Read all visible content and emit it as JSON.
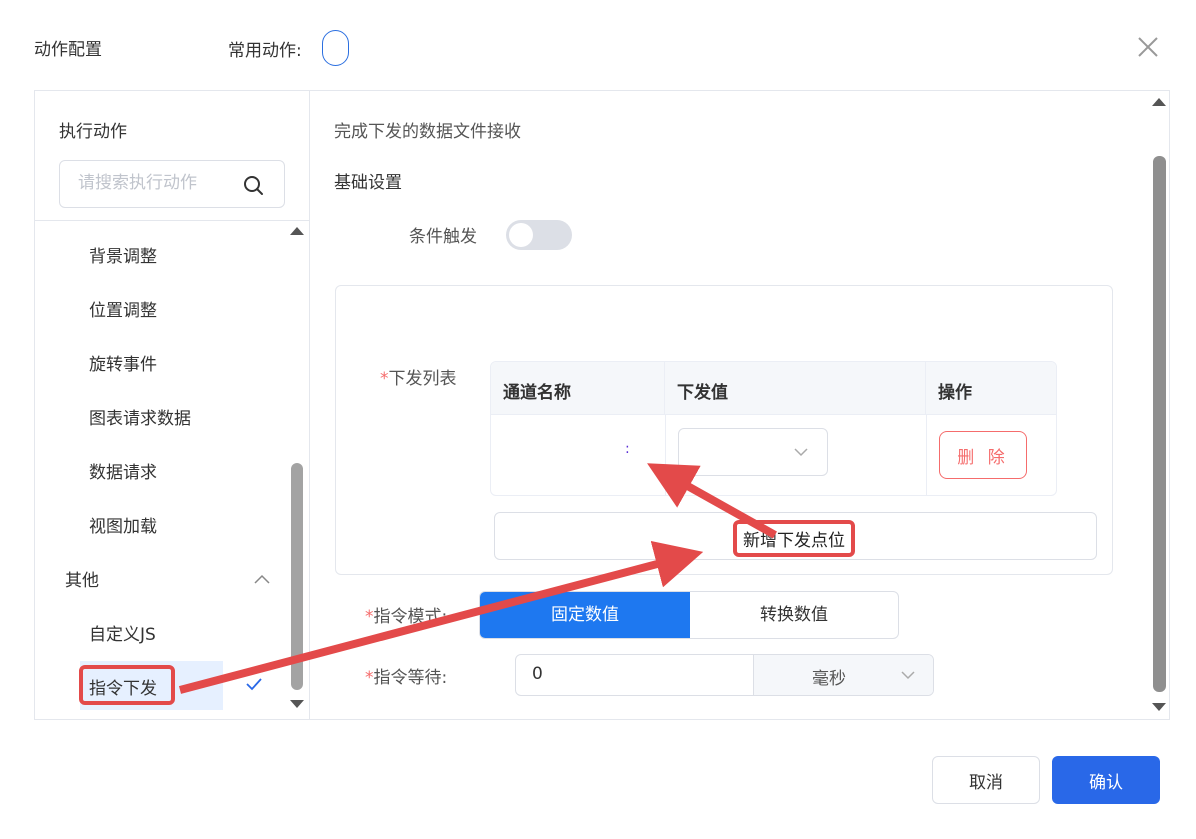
{
  "header": {
    "title": "动作配置",
    "common_actions_label": "常用动作:"
  },
  "left_panel": {
    "title": "执行动作",
    "search_placeholder": "请搜索执行动作",
    "items": [
      {
        "label": "背景调整"
      },
      {
        "label": "位置调整"
      },
      {
        "label": "旋转事件"
      },
      {
        "label": "图表请求数据"
      },
      {
        "label": "数据请求"
      },
      {
        "label": "视图加载"
      }
    ],
    "group": {
      "label": "其他"
    },
    "group_items": [
      {
        "label": "自定义JS"
      },
      {
        "label": "指令下发",
        "selected": true
      }
    ]
  },
  "right_panel": {
    "description": "完成下发的数据文件接收",
    "section_title": "基础设置",
    "condition_trigger_label": "条件触发",
    "condition_trigger_on": false,
    "dispatch_list_label": "下发列表",
    "required_mark": "*",
    "table": {
      "columns": [
        "通道名称",
        "下发值",
        "操作"
      ],
      "rows": [
        {
          "channel": "",
          "value": "",
          "action": "删 除"
        }
      ]
    },
    "add_button_label": "新增下发点位",
    "command_mode_label": "指令模式:",
    "command_mode_options": [
      "固定数值",
      "转换数值"
    ],
    "command_mode_selected": "固定数值",
    "command_wait_label": "指令等待:",
    "command_wait_value": "0",
    "command_wait_unit": "毫秒"
  },
  "footer": {
    "cancel_label": "取消",
    "confirm_label": "确认"
  },
  "colors": {
    "primary": "#2968e8",
    "segment_active": "#1e78f0",
    "danger": "#f56c6c",
    "annotation": "#e34a4a"
  }
}
